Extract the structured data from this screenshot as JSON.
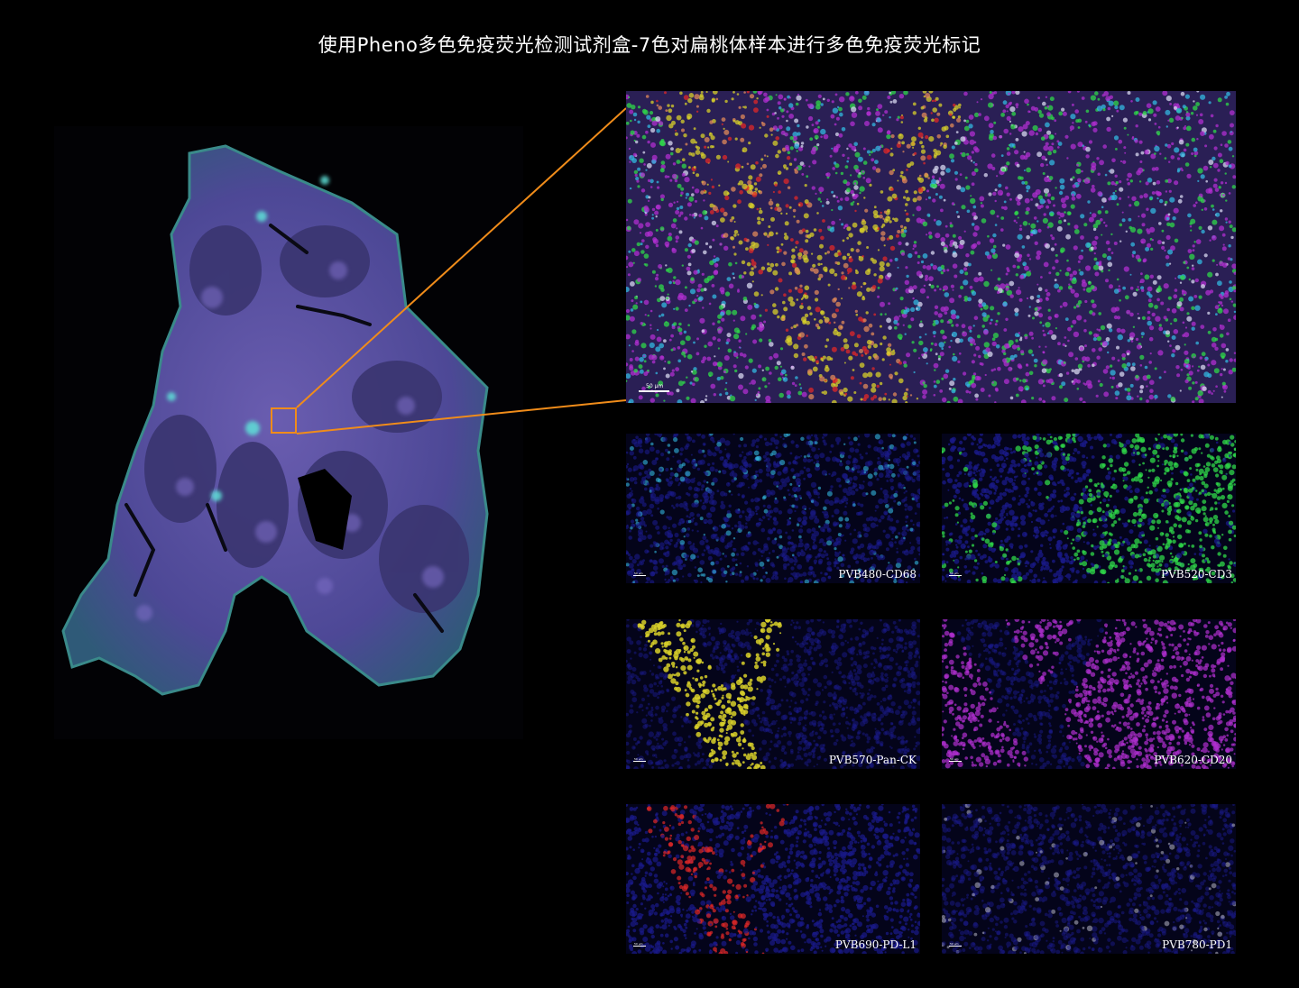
{
  "title": "使用Pheno多色免疫荧光检测试剂盒-7色对扁桃体样本进行多色免疫荧光标记",
  "colors": {
    "background": "#000000",
    "zoom_outline": "#f08c1a",
    "tissue_base": "#5a4f9e",
    "cd68": "#33b8e0",
    "cd3": "#2fd84a",
    "pan_ck": "#d8d02a",
    "cd20": "#b02fd0",
    "pd_l1": "#e02828",
    "pd1": "#c8c8d8",
    "dapi": "#1a1a8a"
  },
  "overview": {
    "scale_label": "50 µm"
  },
  "panels": [
    {
      "label": "PVB480-CD68",
      "channel": "cd68",
      "scale_label": "50 µm"
    },
    {
      "label": "PVB520-CD3",
      "channel": "cd3",
      "scale_label": "50 µm"
    },
    {
      "label": "PVB570-Pan-CK",
      "channel": "pan_ck",
      "scale_label": "50 µm"
    },
    {
      "label": "PVB620-CD20",
      "channel": "cd20",
      "scale_label": "50 µm"
    },
    {
      "label": "PVB690-PD-L1",
      "channel": "pd_l1",
      "scale_label": "50 µm"
    },
    {
      "label": "PVB780-PD1",
      "channel": "pd1",
      "scale_label": "50 µm"
    }
  ]
}
